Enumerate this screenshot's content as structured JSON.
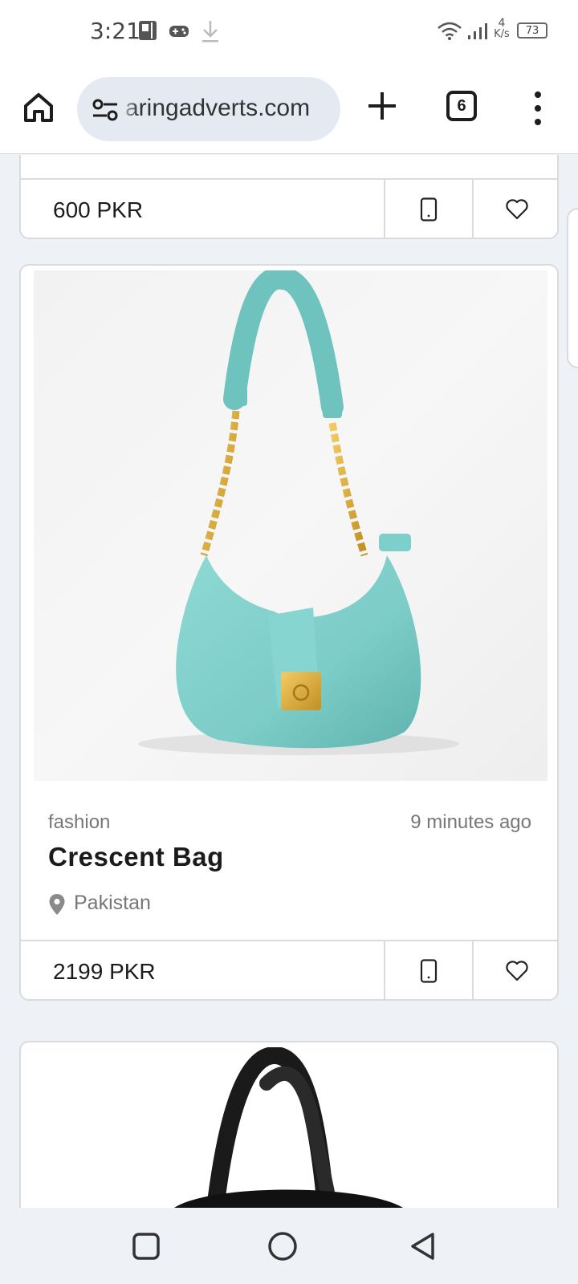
{
  "status_bar": {
    "time": "3:21",
    "net_speed_value": "4",
    "net_speed_unit": "K/s",
    "battery": "73",
    "icons": [
      "pip-icon",
      "gamepad-icon",
      "download-icon",
      "wifi-icon",
      "signal-icon",
      "battery-icon"
    ]
  },
  "browser": {
    "url": "aringadverts.com",
    "tab_count": "6",
    "icons": [
      "home-icon",
      "site-settings-icon",
      "plus-icon",
      "more-vert-icon"
    ]
  },
  "listings": [
    {
      "price": "600 PKR"
    },
    {
      "category": "fashion",
      "posted": "9 minutes ago",
      "title": "Crescent Bag",
      "location": "Pakistan",
      "price": "2199 PKR",
      "image": "teal crescent shoulder bag with gold chain"
    },
    {
      "image": "black tote bag"
    }
  ],
  "nav": {
    "icons": [
      "recents-icon",
      "home-circle-icon",
      "back-icon"
    ]
  },
  "colors": {
    "page_bg": "#eef1f6",
    "card_border": "#d8dbe0",
    "url_pill": "#e4e9f2",
    "bag_teal": "#7fcfca",
    "gold": "#d6a63a"
  }
}
